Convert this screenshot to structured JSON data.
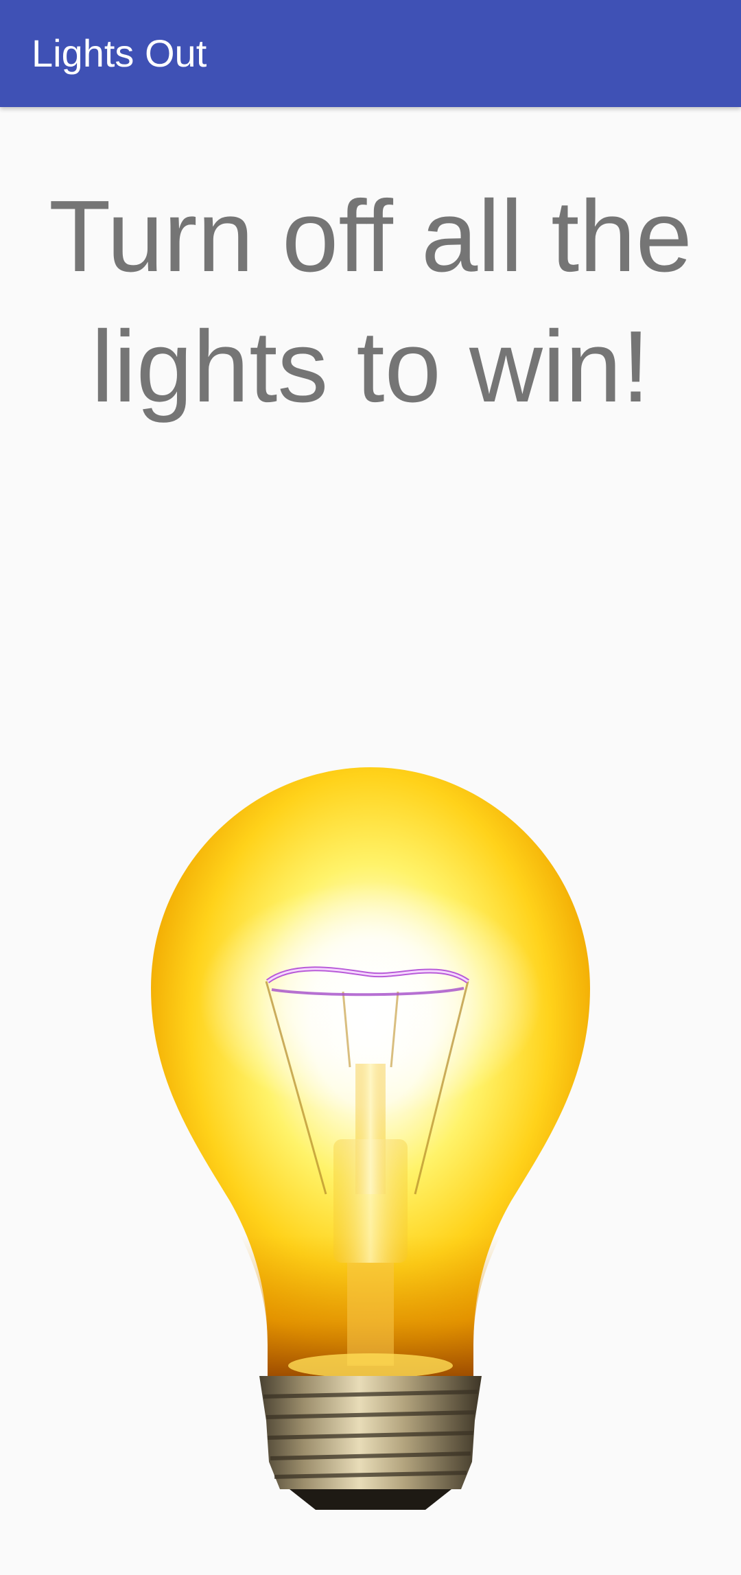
{
  "app_bar": {
    "title": "Lights Out",
    "color": "#3f51b5"
  },
  "main": {
    "instructions": "Turn off all the lights to win!",
    "light_state": "on",
    "bulb_icon": "lightbulb-on-icon"
  }
}
